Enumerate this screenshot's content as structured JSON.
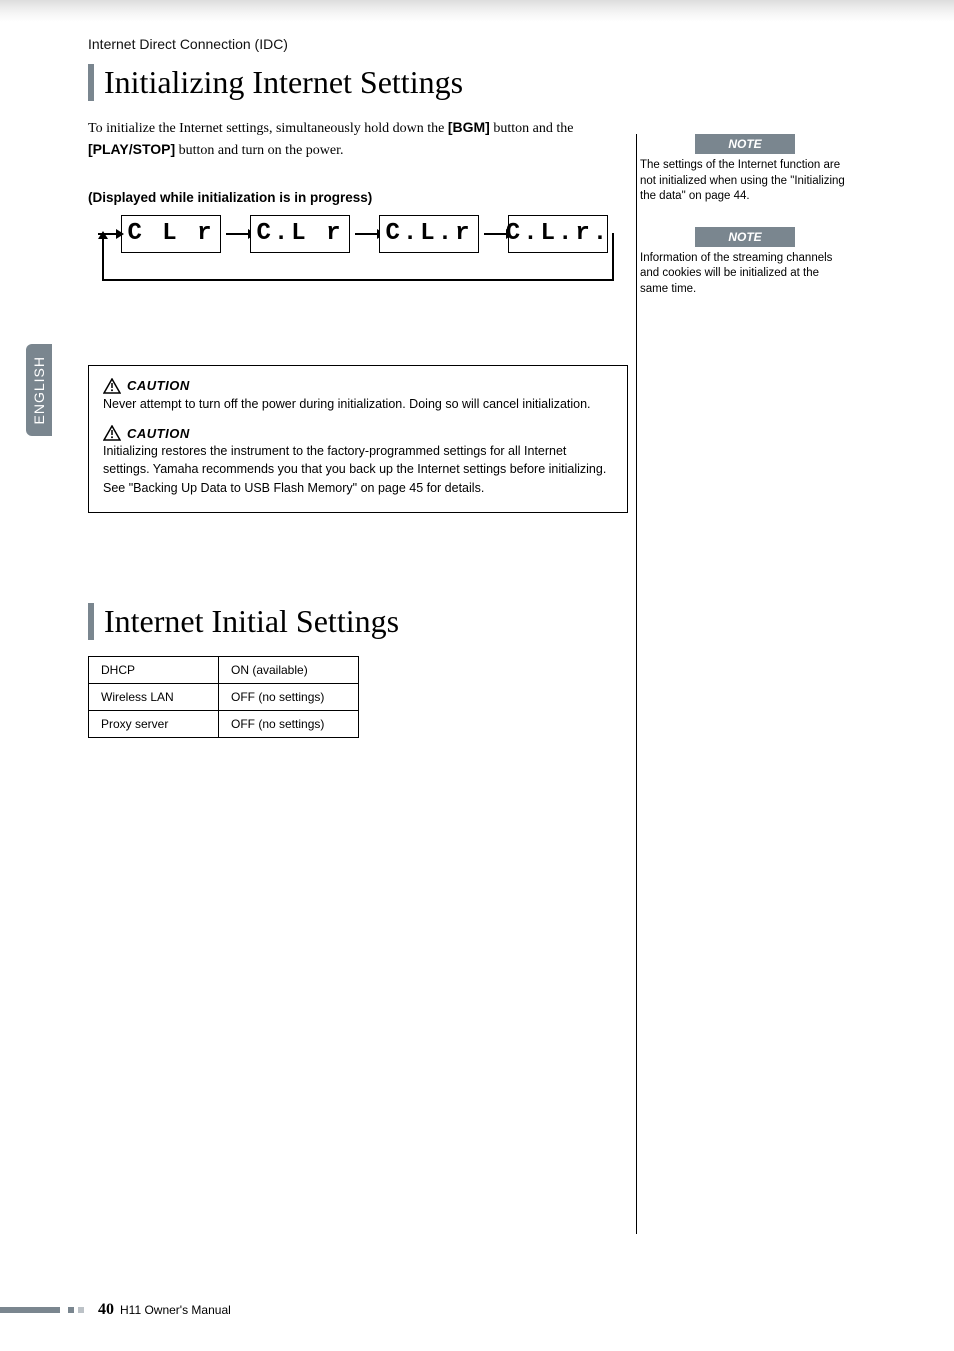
{
  "breadcrumb": "Internet Direct Connection (IDC)",
  "lang_tab": "ENGLISH",
  "section1": {
    "title": "Initializing Internet Settings",
    "intro_prefix": "To initialize the Internet settings, simultaneously hold down the ",
    "intro_btn1": "[BGM]",
    "intro_mid": " button and the ",
    "intro_btn2": "[PLAY/STOP]",
    "intro_suffix": " button and turn on the power.",
    "subcaption": "(Displayed while initialization is in progress)",
    "seg": [
      "C L r",
      "C.L r",
      "C.L.r",
      "C.L.r."
    ],
    "caution_label": "CAUTION",
    "caution1": "Never attempt to turn off the power during initialization. Doing so will cancel initialization.",
    "caution2a": "Initializing restores the instrument to the factory-programmed settings for all Internet settings. Yamaha recommends you that you back up the Internet settings before initializing.",
    "caution2b": "See \"Backing Up Data to USB Flash Memory\" on page 45 for details."
  },
  "section2": {
    "title": "Internet Initial Settings",
    "rows": [
      {
        "k": "DHCP",
        "v": "ON (available)"
      },
      {
        "k": "Wireless LAN",
        "v": "OFF (no settings)"
      },
      {
        "k": "Proxy server",
        "v": "OFF (no settings)"
      }
    ]
  },
  "notes": {
    "label": "NOTE",
    "n1": "The settings of the Internet function are not initialized when using the \"Initializing the data\" on page 44.",
    "n2": "Information of the streaming channels and cookies will be initialized at the same time."
  },
  "footer": {
    "page": "40",
    "doc": "H11 Owner's Manual"
  }
}
